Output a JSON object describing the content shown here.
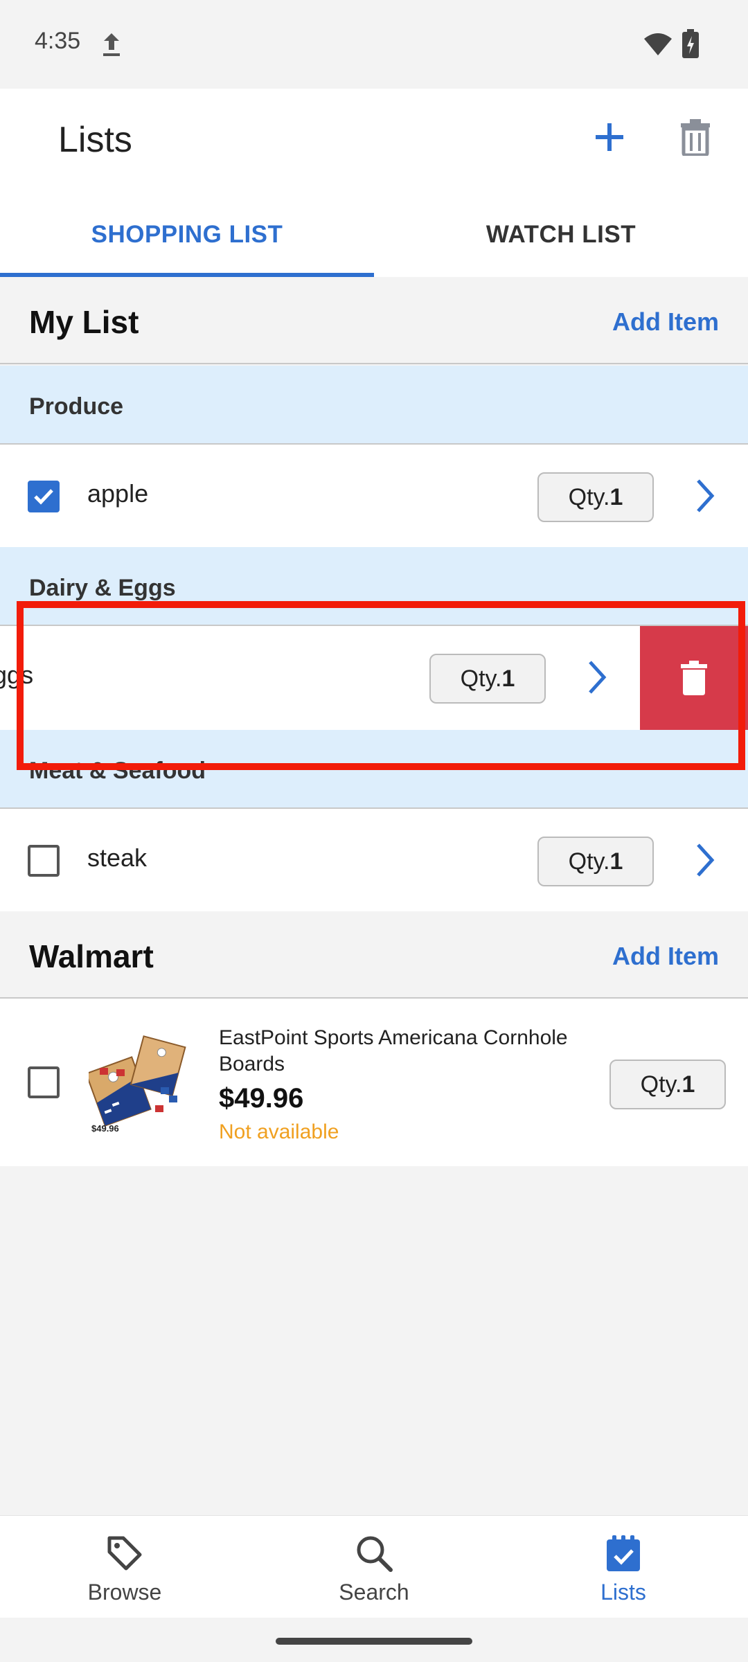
{
  "status_bar": {
    "time": "4:35"
  },
  "app_bar": {
    "title": "Lists"
  },
  "tabs": [
    {
      "label": "SHOPPING LIST",
      "selected": true
    },
    {
      "label": "WATCH LIST",
      "selected": false
    }
  ],
  "my_list": {
    "name": "My List",
    "add_item_label": "Add Item",
    "sections": [
      {
        "label": "Produce",
        "items": [
          {
            "name": "apple",
            "checked": true,
            "qty_prefix": "Qty.",
            "qty": "1"
          }
        ]
      },
      {
        "label": "Dairy & Eggs",
        "items": [
          {
            "name": "eggs",
            "visible_name": "ggs",
            "checked": false,
            "qty_prefix": "Qty.",
            "qty": "1"
          }
        ]
      },
      {
        "label": "Meat & Seafood",
        "items": [
          {
            "name": "steak",
            "checked": false,
            "qty_prefix": "Qty.",
            "qty": "1"
          }
        ]
      }
    ]
  },
  "walmart_list": {
    "name": "Walmart",
    "add_item_label": "Add Item",
    "product": {
      "title": "EastPoint Sports Americana Cornhole Boards",
      "price": "$49.96",
      "status": "Not available",
      "thumb_price": "$49.96",
      "qty_prefix": "Qty.",
      "qty": "1"
    }
  },
  "bottom_nav": [
    {
      "label": "Browse",
      "icon": "tag-icon",
      "active": false
    },
    {
      "label": "Search",
      "icon": "search-icon",
      "active": false
    },
    {
      "label": "Lists",
      "icon": "checklist-icon",
      "active": true
    }
  ],
  "colors": {
    "accent": "#2e6fcf",
    "section_bg": "#ddeefc",
    "delete": "#d63a4a",
    "warning": "#f0a020",
    "highlight": "#f21c0a"
  }
}
